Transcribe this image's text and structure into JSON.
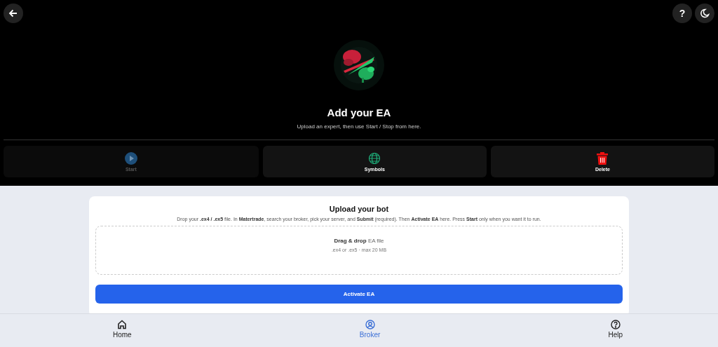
{
  "header": {
    "help_button": "?",
    "title": "Add your EA",
    "subtitle": "Upload an expert, then use Start / Stop from here."
  },
  "actions": [
    {
      "kind": "play",
      "label": "Start",
      "disabled": true
    },
    {
      "kind": "globe",
      "label": "Symbols",
      "disabled": false
    },
    {
      "kind": "trash",
      "label": "Delete",
      "disabled": false
    }
  ],
  "upload": {
    "title": "Upload your bot",
    "description": "Drop your **.ex4 / .ex5** file. In **Matertrade**, search your broker, pick your server, and **Submit** (required). Then **Activate EA** here. Press **Start** only when you want it to run.",
    "drop_label": "**Drag & drop** EA file",
    "drop_hint": ".ex4 or .ex5 · max 20 MB",
    "button": "Activate EA"
  },
  "nav": [
    {
      "kind": "home",
      "label": "Home",
      "selected": false
    },
    {
      "kind": "user",
      "label": "Broker",
      "selected": true
    },
    {
      "kind": "help",
      "label": "Help",
      "selected": false
    }
  ]
}
